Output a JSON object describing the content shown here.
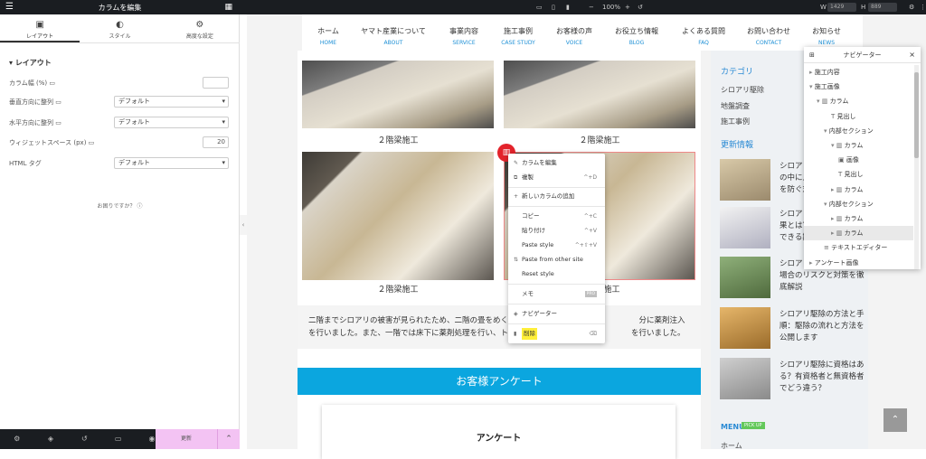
{
  "panel": {
    "title": "カラムを編集",
    "tabs": [
      {
        "label": "レイアウト",
        "icon": "layout-icon"
      },
      {
        "label": "スタイル",
        "icon": "style-icon"
      },
      {
        "label": "高度な設定",
        "icon": "gear-icon"
      }
    ],
    "section": "レイアウト",
    "controls": [
      {
        "label": "カラム幅 (%)",
        "type": "input",
        "value": ""
      },
      {
        "label": "垂直方向に整列",
        "type": "select",
        "value": "デフォルト"
      },
      {
        "label": "水平方向に整列",
        "type": "select",
        "value": "デフォルト"
      },
      {
        "label": "ウィジェットスペース (px)",
        "type": "input",
        "value": "20"
      },
      {
        "label": "HTML タグ",
        "type": "select",
        "value": "デフォルト"
      }
    ],
    "help": "お困りですか？",
    "update": "更新"
  },
  "topbar": {
    "zoom": "100%",
    "w_label": "W",
    "w_value": "1429",
    "h_label": "H",
    "h_value": "889"
  },
  "site": {
    "nav": [
      {
        "jp": "ホーム",
        "en": "HOME"
      },
      {
        "jp": "ヤマト産業について",
        "en": "ABOUT"
      },
      {
        "jp": "事業内容",
        "en": "SERVICE"
      },
      {
        "jp": "施工事例",
        "en": "CASE STUDY"
      },
      {
        "jp": "お客様の声",
        "en": "VOICE"
      },
      {
        "jp": "お役立ち情報",
        "en": "BLOG"
      },
      {
        "jp": "よくある質問",
        "en": "FAQ"
      },
      {
        "jp": "お問い合わせ",
        "en": "CONTACT"
      },
      {
        "jp": "お知らせ",
        "en": "NEWS"
      }
    ],
    "captions": [
      "２階梁施工",
      "２階梁施工",
      "２階梁施工",
      "２階梁施工"
    ],
    "paragraph": "二階までシロアリの被害が見られたため、二階の畳をめく　　　　　　　　　　　　　　　　　分に薬剤注入を行いました。また、一階では床下に薬剤処理を行い、トイレや玄関　　　　　　　　　　　を行いました。",
    "banner": "お客様アンケート",
    "survey_title": "アンケート"
  },
  "sidebar": {
    "category_title": "カテゴリ",
    "categories": [
      "シロアリ駆除",
      "地盤調査",
      "施工事例"
    ],
    "news_title": "更新情報",
    "posts": [
      "シロアリはどこ\nの中に入\nを防ぐ対",
      "シロアリ\n果とは？\nできる期",
      "シロアリ\n場合のリスクと対策を徹底解説",
      "シロアリ駆除の方法と手順：駆除の流れと方法を公開します",
      "シロアリ駆除に資格はある？有資格者と無資格者でどう違う？"
    ],
    "menu_title": "MENU",
    "pickup": "PICK UP",
    "home": "ホーム"
  },
  "context_menu": {
    "items": [
      {
        "label": "カラムを編集",
        "shortcut": "",
        "icon": "pencil-icon"
      },
      {
        "label": "複製",
        "shortcut": "^+D",
        "icon": "copy-icon"
      },
      {
        "label": "新しいカラムの追加",
        "shortcut": "",
        "icon": "plus-icon"
      },
      {
        "label": "コピー",
        "shortcut": "^+C",
        "icon": ""
      },
      {
        "label": "貼り付け",
        "shortcut": "^+V",
        "icon": ""
      },
      {
        "label": "Paste style",
        "shortcut": "^+⇧+V",
        "icon": ""
      },
      {
        "label": "Paste from other site",
        "shortcut": "",
        "icon": "paste-icon"
      },
      {
        "label": "Reset style",
        "shortcut": "",
        "icon": ""
      },
      {
        "label": "メモ",
        "shortcut": "",
        "badge": "PRO",
        "icon": ""
      },
      {
        "label": "ナビゲーター",
        "shortcut": "",
        "icon": "layers-icon"
      },
      {
        "label": "削除",
        "shortcut": "⌫",
        "icon": "trash-icon"
      }
    ]
  },
  "navigator": {
    "title": "ナビゲーター",
    "items": [
      {
        "label": "施工内容",
        "indent": 0,
        "arrow": "▸",
        "icon": ""
      },
      {
        "label": "施工画像",
        "indent": 0,
        "arrow": "▾",
        "icon": ""
      },
      {
        "label": "カラム",
        "indent": 1,
        "arrow": "▾",
        "icon": "▥"
      },
      {
        "label": "見出し",
        "indent": 3,
        "arrow": "",
        "icon": "T"
      },
      {
        "label": "内部セクション",
        "indent": 2,
        "arrow": "▾",
        "icon": ""
      },
      {
        "label": "カラム",
        "indent": 3,
        "arrow": "▾",
        "icon": "▥"
      },
      {
        "label": "画像",
        "indent": 4,
        "arrow": "",
        "icon": "▣"
      },
      {
        "label": "見出し",
        "indent": 4,
        "arrow": "",
        "icon": "T"
      },
      {
        "label": "カラム",
        "indent": 3,
        "arrow": "▸",
        "icon": "▥"
      },
      {
        "label": "内部セクション",
        "indent": 2,
        "arrow": "▾",
        "icon": ""
      },
      {
        "label": "カラム",
        "indent": 3,
        "arrow": "▸",
        "icon": "▥"
      },
      {
        "label": "カラム",
        "indent": 3,
        "arrow": "▸",
        "icon": "▥",
        "selected": true
      },
      {
        "label": "テキストエディター",
        "indent": 2,
        "arrow": "",
        "icon": "≡"
      },
      {
        "label": "アンケート画像",
        "indent": 0,
        "arrow": "▸",
        "icon": ""
      }
    ]
  },
  "colors": {
    "accent": "#0ba6df",
    "update_bg": "#f3c3f3",
    "badge_red": "#e3232b",
    "highlight": "#ffef3a"
  }
}
